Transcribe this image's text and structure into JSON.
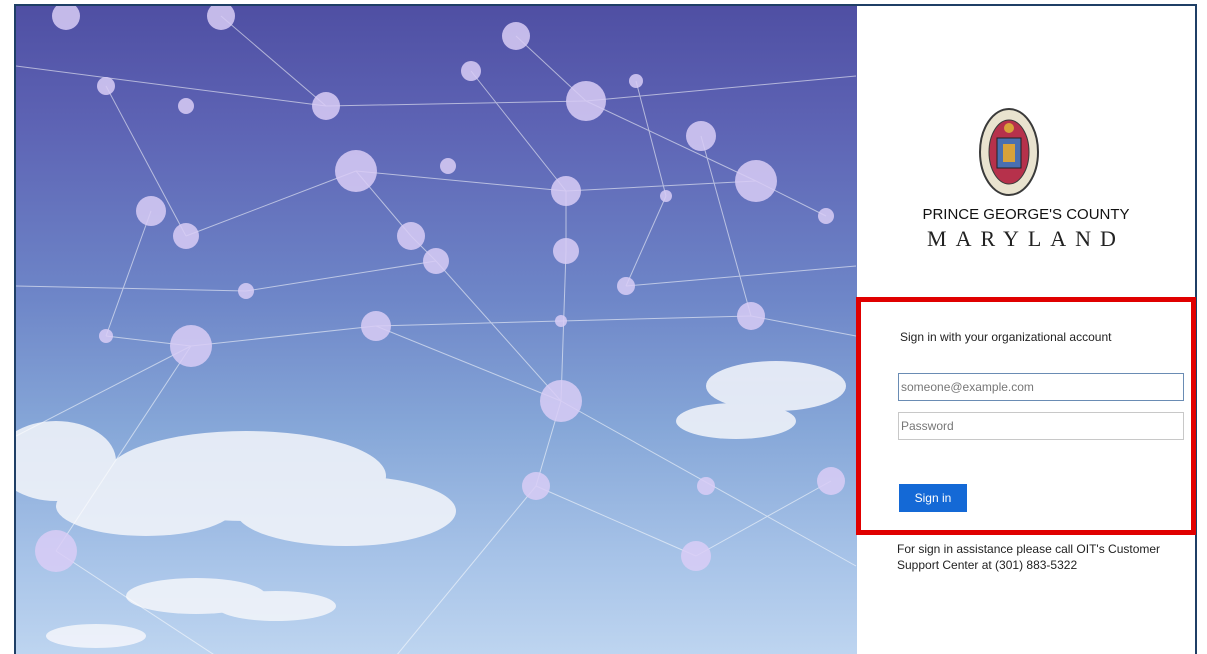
{
  "branding": {
    "county_name": "PRINCE GEORGE'S COUNTY",
    "state_name": "MARYLAND",
    "seal_icon": "county-seal-icon"
  },
  "signin": {
    "heading": "Sign in with your organizational account",
    "username_placeholder": "someone@example.com",
    "password_placeholder": "Password",
    "button_label": "Sign in",
    "help_text": "For sign in assistance please call OIT's Customer Support Center at (301) 883-5322"
  },
  "colors": {
    "accent": "#1469d6",
    "highlight_border": "#e00000",
    "frame_border": "#1f3f66"
  }
}
